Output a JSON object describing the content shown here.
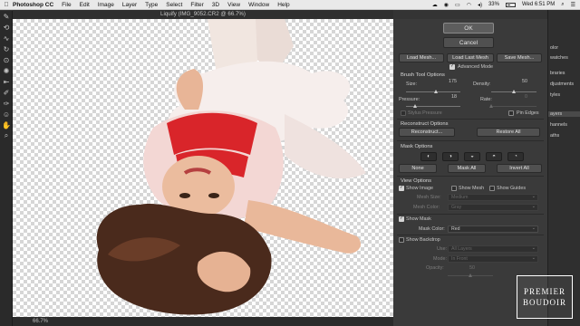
{
  "menubar": {
    "apple_icon": "apple-icon",
    "app_name": "Photoshop CC",
    "menus": [
      "File",
      "Edit",
      "Image",
      "Layer",
      "Type",
      "Select",
      "Filter",
      "3D",
      "View",
      "Window",
      "Help"
    ],
    "battery": "33%",
    "clock": "Wed 6:51 PM"
  },
  "dialog": {
    "title": "Liquify (IMG_9052.CR2 @ 66.7%)",
    "ok_label": "OK",
    "cancel_label": "Cancel",
    "load_mesh_label": "Load Mesh...",
    "load_last_mesh_label": "Load Last Mesh",
    "save_mesh_label": "Save Mesh...",
    "advanced_mode_label": "Advanced Mode",
    "advanced_mode_checked": true,
    "brush_tool_options": {
      "header": "Brush Tool Options",
      "size_label": "Size:",
      "size_value": "175",
      "size_fraction": 0.55,
      "density_label": "Density:",
      "density_value": "50",
      "density_fraction": 0.5,
      "pressure_label": "Pressure:",
      "pressure_value": "18",
      "pressure_fraction": 0.18,
      "rate_label": "Rate:",
      "rate_value": "0",
      "rate_fraction": 0.0,
      "stylus_pressure_label": "Stylus Pressure",
      "pin_edges_label": "Pin Edges"
    },
    "reconstruct_options": {
      "header": "Reconstruct Options",
      "reconstruct_label": "Reconstruct...",
      "restore_all_label": "Restore All"
    },
    "mask_options": {
      "header": "Mask Options",
      "none_label": "None",
      "mask_all_label": "Mask All",
      "invert_all_label": "Invert All"
    },
    "view_options": {
      "header": "View Options",
      "show_image_label": "Show Image",
      "show_image_checked": true,
      "show_mesh_label": "Show Mesh",
      "show_guides_label": "Show Guides",
      "mesh_size_label": "Mesh Size:",
      "mesh_size_value": "Medium",
      "mesh_color_label": "Mesh Color:",
      "mesh_color_value": "Gray",
      "show_mask_label": "Show Mask",
      "show_mask_checked": true,
      "mask_color_label": "Mask Color:",
      "mask_color_value": "Red",
      "show_backdrop_label": "Show Backdrop",
      "use_label": "Use:",
      "use_value": "All Layers",
      "mode_label": "Mode:",
      "mode_value": "In Front",
      "opacity_label": "Opacity:",
      "opacity_value": "50",
      "opacity_fraction": 0.5
    },
    "zoom": "66.7%"
  },
  "side_panels": [
    "olor",
    "watches",
    "braries",
    "djustments",
    "tyles",
    "ayers",
    "hannels",
    "aths"
  ],
  "watermark": {
    "line1": "PREMIER",
    "line2": "BOUDOIR"
  },
  "colors": {
    "panel_bg": "#3a3a3a",
    "canvas_checker": "#d6d6d6",
    "dress_red": "#d9252a",
    "skin": "#e9b89a",
    "hair": "#4a2a1c"
  }
}
